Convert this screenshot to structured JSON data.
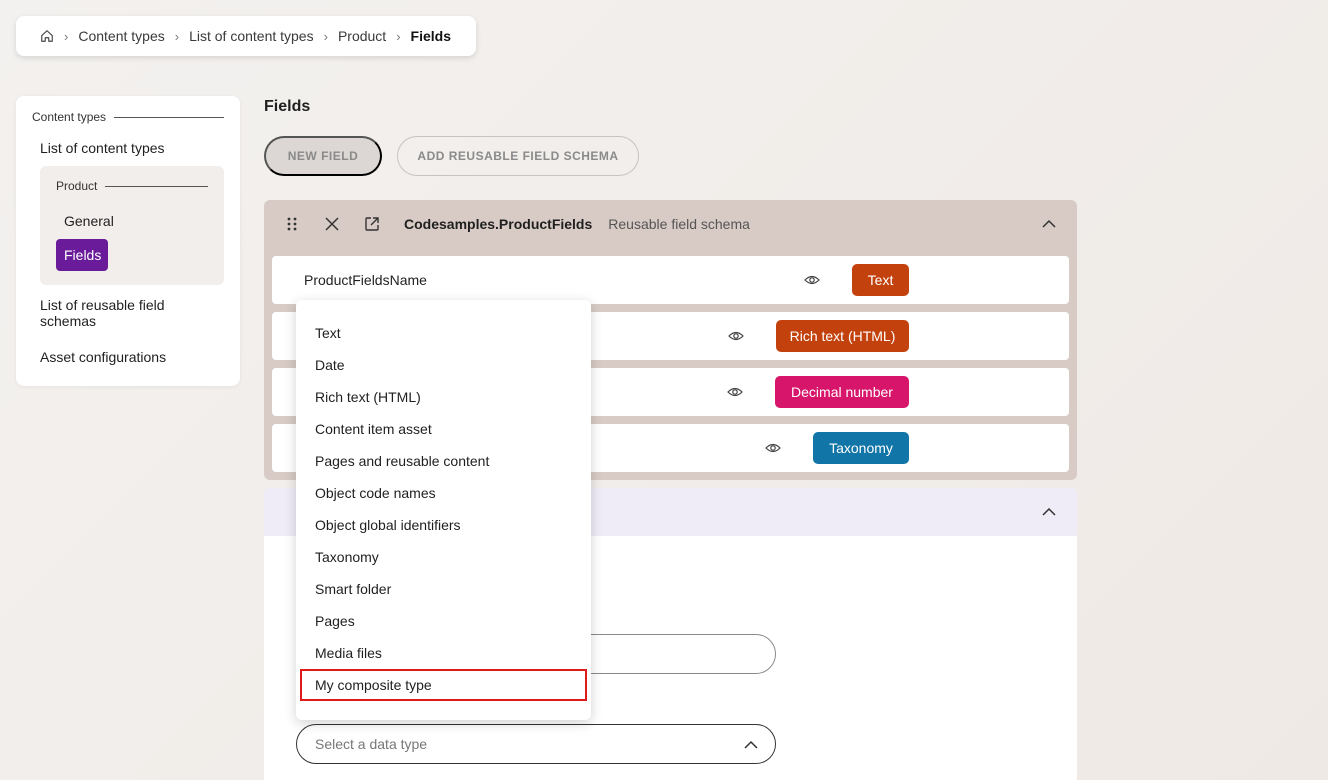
{
  "breadcrumb": {
    "items": [
      "Content types",
      "List of content types",
      "Product",
      "Fields"
    ]
  },
  "sidebar": {
    "section_title": "Content types",
    "list_link": "List of content types",
    "group_title": "Product",
    "group_items": [
      "General",
      "Fields"
    ],
    "reusable_link": "List of reusable field schemas",
    "asset_link": "Asset configurations"
  },
  "main": {
    "title": "Fields",
    "new_field_label": "NEW FIELD",
    "add_schema_label": "ADD REUSABLE FIELD SCHEMA"
  },
  "schema": {
    "name": "Codesamples.ProductFields",
    "subtitle": "Reusable field schema",
    "fields": [
      {
        "name": "ProductFieldsName",
        "type": "Text",
        "color": "#c2410c"
      },
      {
        "name": "",
        "type": "Rich text (HTML)",
        "color": "#c2410c"
      },
      {
        "name": "",
        "type": "Decimal number",
        "color": "#d6156b"
      },
      {
        "name": "",
        "type": "Taxonomy",
        "color": "#1175a8"
      }
    ]
  },
  "new_field": {
    "select_placeholder": "Select a data type"
  },
  "dropdown": {
    "options": [
      "Text",
      "Date",
      "Rich text (HTML)",
      "Content item asset",
      "Pages and reusable content",
      "Object code names",
      "Object global identifiers",
      "Taxonomy",
      "Smart folder",
      "Pages",
      "Media files",
      "My composite type"
    ],
    "highlighted": "My composite type",
    "highlight_color": "#e0191b"
  },
  "colors": {
    "active_nav": "#6a1b9a",
    "schema_panel": "#d8cbc5"
  }
}
